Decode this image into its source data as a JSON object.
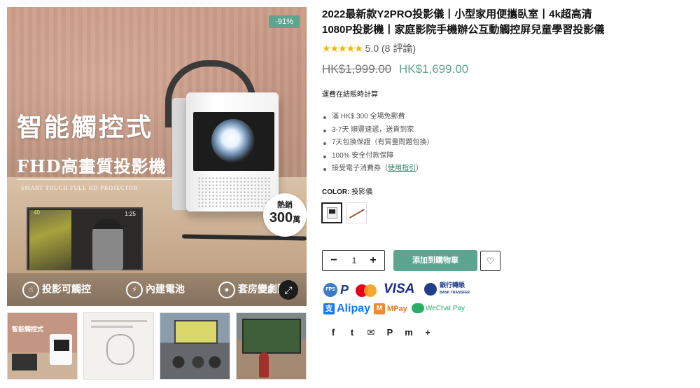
{
  "gallery": {
    "discount_badge": "-91%",
    "promo_title": "智能觸控式",
    "promo_subtitle": "FHD高畫質投影機",
    "promo_english": "SMART TOUCH FULL HD PROJECTOR",
    "hot_label": "熱銷",
    "hot_number": "300",
    "hot_unit": "萬",
    "inset_temp": "40",
    "inset_time": "1:25",
    "features": [
      {
        "label": "投影可觸控",
        "icon": "touch-icon"
      },
      {
        "label": "內建電池",
        "icon": "battery-icon"
      },
      {
        "label": "套房變劇院",
        "icon": "camera-icon"
      }
    ],
    "zoom_icon": "expand-icon",
    "thumbnails": [
      {
        "caption": "智能觸控式"
      },
      {
        "caption": ""
      },
      {
        "caption": ""
      },
      {
        "caption": ""
      }
    ]
  },
  "product": {
    "title": "2022最新款Y2PRO投影儀丨小型家用便攜臥室丨4k超高清1080P投影機丨家庭影院手機辦公互動觸控屏兒童學習投影儀",
    "stars": "★★★★★",
    "rating_value": "5.0",
    "rating_count": "(8 評論)",
    "old_price": "HK$1,999.00",
    "new_price": "HK$1,699.00",
    "shipping_note": "運費在結賬時計算",
    "benefits": [
      "滿 HK$ 300 全場免郵費",
      "3-7天 順豐速遞，送貨到家",
      "7天包換保證（有質量問題包換）",
      "100% 安全付款保障"
    ],
    "voucher_prefix": "接受電子消費券（",
    "voucher_link": "使用指引",
    "voucher_suffix": "）",
    "color_label": "COLOR:",
    "color_value": "投影儀",
    "quantity": "1",
    "add_to_cart": "添加到購物車",
    "wishlist_icon": "heart-icon"
  },
  "payments": {
    "fps": "FPS",
    "paypal": "P",
    "mastercard": "MasterCard",
    "visa": "VISA",
    "bank_transfer": "銀行轉賬",
    "bank_transfer_en": "BANK TRANSFER",
    "alipay": "Alipay",
    "mpay": "MPay",
    "wechat_pay": "WeChat Pay"
  },
  "share": {
    "facebook": "f",
    "twitter": "t",
    "email": "✉",
    "pinterest": "P",
    "messenger": "m",
    "more": "+"
  },
  "colors": {
    "accent": "#5da58f",
    "text": "#111111",
    "muted": "#777777"
  }
}
